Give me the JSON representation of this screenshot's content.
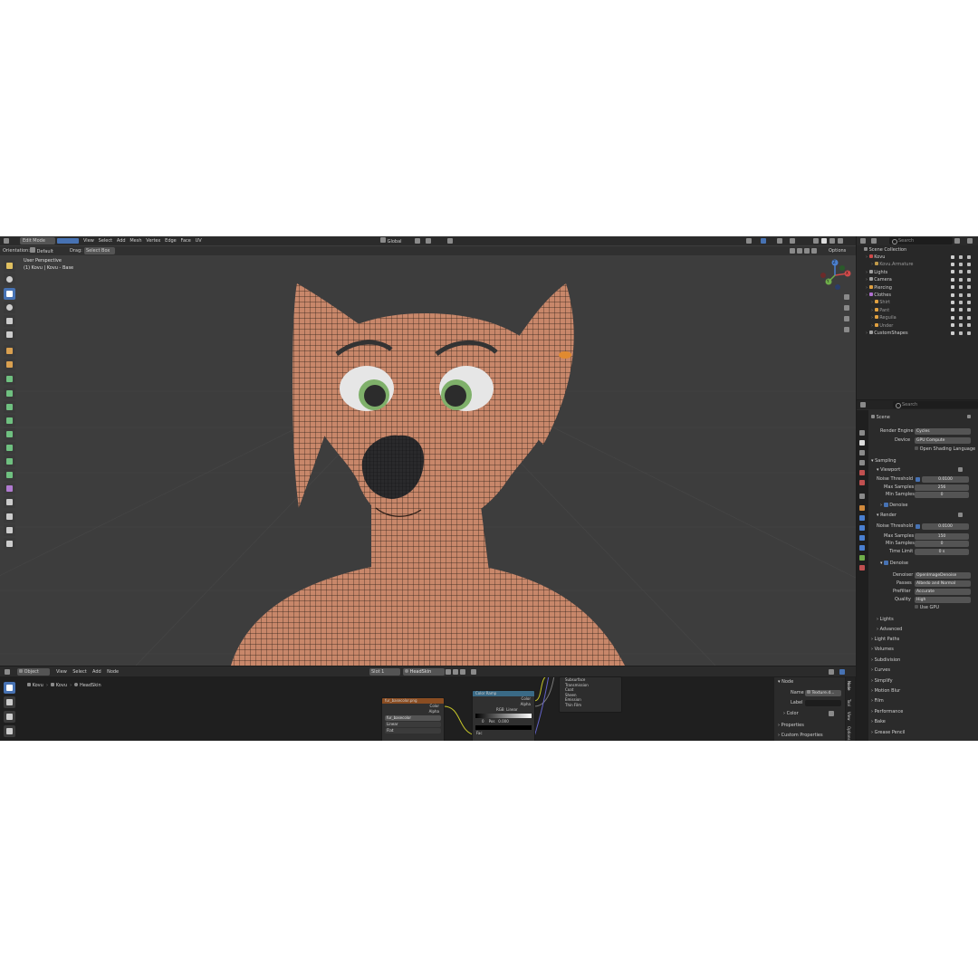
{
  "viewport_header": {
    "mode": "Edit Mode",
    "menus": [
      "View",
      "Select",
      "Add",
      "Mesh",
      "Vertex",
      "Edge",
      "Face",
      "UV"
    ],
    "transform_orientation": "Global"
  },
  "tool_header": {
    "orientation_label": "Orientation:",
    "orientation_value": "Default",
    "drag_label": "Drag:",
    "drag_value": "Select Box",
    "options_label": "Options"
  },
  "viewport": {
    "view_name": "User Perspective",
    "object_info": "(1) Kovu | Kovu - Base",
    "gizmo": {
      "x": "X",
      "y": "Y",
      "z": "Z"
    }
  },
  "outliner": {
    "search_placeholder": "Search",
    "root": "Scene Collection",
    "items": [
      {
        "label": "Kovu",
        "level": 1,
        "color": "#d04a4a"
      },
      {
        "label": "Kovu.Armature",
        "level": 2,
        "color": "#c09a4a"
      },
      {
        "label": "Lights",
        "level": 1,
        "color": "#a0a0a0"
      },
      {
        "label": "Camera",
        "level": 1,
        "color": "#a0a0a0"
      },
      {
        "label": "Piercing",
        "level": 1,
        "color": "#e0a040"
      },
      {
        "label": "Clothes",
        "level": 1,
        "color": "#b070d0"
      },
      {
        "label": "Shirt",
        "level": 2,
        "color": "#e0a040"
      },
      {
        "label": "Pant",
        "level": 2,
        "color": "#e0a040"
      },
      {
        "label": "Reguila",
        "level": 2,
        "color": "#e0a040"
      },
      {
        "label": "Under",
        "level": 2,
        "color": "#e0a040"
      },
      {
        "label": "CustomShapes",
        "level": 1,
        "color": "#a0a0a0"
      }
    ]
  },
  "properties": {
    "search_placeholder": "Search",
    "scene_name": "Scene",
    "render_engine_label": "Render Engine",
    "render_engine_value": "Cycles",
    "device_label": "Device",
    "device_value": "GPU Compute",
    "osl_label": "Open Shading Language",
    "sampling_label": "Sampling",
    "viewport_label": "Viewport",
    "noise_threshold_label": "Noise Threshold",
    "viewport_noise_threshold": "0.0100",
    "max_samples_label": "Max Samples",
    "viewport_max_samples": "256",
    "min_samples_label": "Min Samples",
    "viewport_min_samples": "0",
    "denoise_label": "Denoise",
    "render_label": "Render",
    "render_noise_threshold": "0.0100",
    "render_max_samples": "150",
    "render_min_samples": "0",
    "time_limit_label": "Time Limit",
    "time_limit_value": "0 s",
    "denoiser_label": "Denoiser",
    "denoiser_value": "OpenImageDenoise",
    "passes_label": "Passes",
    "passes_value": "Albedo and Normal",
    "prefilter_label": "Prefilter",
    "prefilter_value": "Accurate",
    "quality_label": "Quality",
    "quality_value": "High",
    "use_gpu_label": "Use GPU",
    "lights_label": "Lights",
    "advanced_label": "Advanced",
    "panels": [
      "Light Paths",
      "Volumes",
      "Subdivision",
      "Curves",
      "Simplify",
      "Motion Blur",
      "Film",
      "Performance",
      "Bake",
      "Grease Pencil"
    ]
  },
  "node_editor": {
    "header": {
      "type_value": "Object",
      "menus": [
        "View",
        "Select",
        "Add",
        "Node"
      ],
      "slot_value": "Slot 1",
      "material_value": "HeadSkin"
    },
    "breadcrumb": [
      "Kovu",
      "Kovu",
      "HeadSkin"
    ],
    "sidebar": {
      "node_section": "Node",
      "name_label": "Name",
      "name_value": "Texture.d...",
      "label_label": "Label",
      "color_label": "Color",
      "properties_label": "Properties",
      "custom_properties_label": "Custom Properties",
      "tabs": [
        "Node",
        "Tool",
        "View",
        "Options"
      ]
    },
    "image_node": {
      "title": "fur_basecolor.png",
      "outputs": [
        "Color",
        "Alpha"
      ],
      "image_value": "fur_basecolor",
      "options": [
        "Linear",
        "Flat",
        "Repeat"
      ]
    },
    "ramp_node": {
      "title": "Color Ramp",
      "outputs": [
        "Color",
        "Alpha"
      ],
      "mode_rgb": "RGB",
      "mode_linear": "Linear",
      "stop_index": "0",
      "pos_label": "Pos",
      "pos_value": "0.000",
      "fac_label": "Fac"
    },
    "bsdf_node": {
      "sockets": [
        "Subsurface",
        "Transmission",
        "Coat",
        "Sheen",
        "Emission",
        "Thin Film"
      ]
    }
  },
  "colors": {
    "accent": "#4772b3",
    "viewport_bg": "#3d3d3d",
    "skin": "#c8876a",
    "iris": "#7fb06a"
  }
}
